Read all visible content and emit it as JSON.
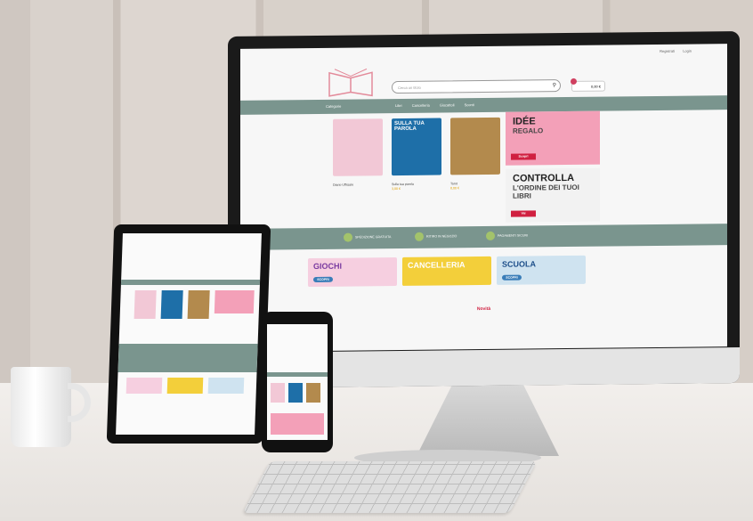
{
  "site": {
    "topbar": {
      "register": "Registrati",
      "login": "Login"
    },
    "search_placeholder": "Cerca un titolo",
    "cart_label": "0,00 €",
    "nav": {
      "categories": "Categorie",
      "links": [
        "Libri",
        "Cancelleria",
        "Giocattoli",
        "Sconti"
      ]
    },
    "products": [
      {
        "title": "Diario Ufficiale",
        "price": "",
        "color": "#f2c8d6"
      },
      {
        "title": "Sulla tua parola",
        "price": "3,00 €",
        "color": "#1e6fa8",
        "cover_text": "SULLA TUA PAROLA"
      },
      {
        "title": "Tarot",
        "price": "8,00 €",
        "color": "#b38a4d"
      }
    ],
    "promos": [
      {
        "line1": "IDÉE",
        "line2": "REGALO",
        "button": "Scopri"
      },
      {
        "line1": "CONTROLLA",
        "line2": "L'ORDINE DEI TUOI LIBRI",
        "button": "Vai"
      }
    ],
    "features": [
      "SPEDIZIONE GRATUITA",
      "RITIRO IN NEGOZIO",
      "PAGAMENTI SICURI"
    ],
    "categories": [
      {
        "label": "GIOCHI",
        "button": "SCOPRI",
        "color": "#f6cfe0"
      },
      {
        "label": "CANCELLERIA",
        "button": "",
        "color": "#f3cf3a"
      },
      {
        "label": "SCUOLA",
        "button": "SCOPRI",
        "color": "#cfe3f0"
      }
    ],
    "section_title": "Novità"
  },
  "colors": {
    "nav": "#7a958e",
    "accent": "#d02040",
    "feature_icon": "#a3c36b"
  }
}
